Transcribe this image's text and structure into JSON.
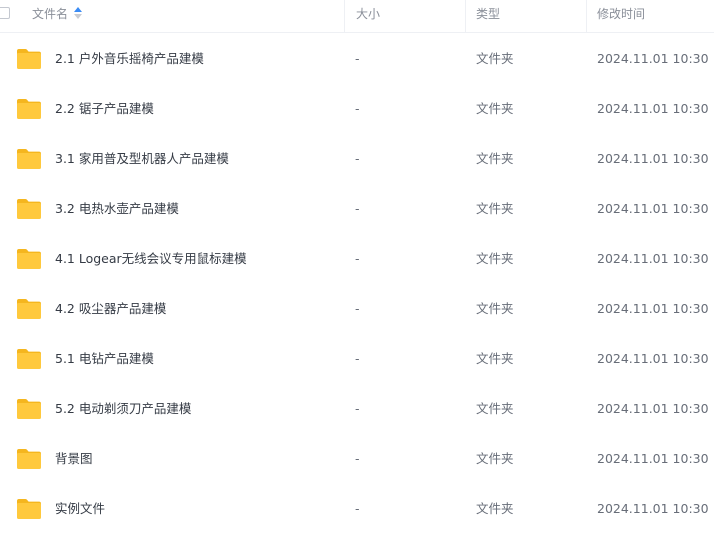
{
  "header": {
    "name_label": "文件名",
    "size_label": "大小",
    "type_label": "类型",
    "time_label": "修改时间",
    "sort_icon": "sort-arrows-icon"
  },
  "colors": {
    "folder_yellow": "#ffc93d",
    "folder_tab": "#f5b61e",
    "sort_active": "#3b8cf5"
  },
  "rows": [
    {
      "name": "2.1 户外音乐摇椅产品建模",
      "size": "-",
      "type": "文件夹",
      "modified": "2024.11.01 10:30",
      "icon": "folder-icon"
    },
    {
      "name": "2.2 锯子产品建模",
      "size": "-",
      "type": "文件夹",
      "modified": "2024.11.01 10:30",
      "icon": "folder-icon"
    },
    {
      "name": "3.1 家用普及型机器人产品建模",
      "size": "-",
      "type": "文件夹",
      "modified": "2024.11.01 10:30",
      "icon": "folder-icon"
    },
    {
      "name": "3.2 电热水壶产品建模",
      "size": "-",
      "type": "文件夹",
      "modified": "2024.11.01 10:30",
      "icon": "folder-icon"
    },
    {
      "name": "4.1 Logear无线会议专用鼠标建模",
      "size": "-",
      "type": "文件夹",
      "modified": "2024.11.01 10:30",
      "icon": "folder-icon"
    },
    {
      "name": "4.2 吸尘器产品建模",
      "size": "-",
      "type": "文件夹",
      "modified": "2024.11.01 10:30",
      "icon": "folder-icon"
    },
    {
      "name": "5.1 电钻产品建模",
      "size": "-",
      "type": "文件夹",
      "modified": "2024.11.01 10:30",
      "icon": "folder-icon"
    },
    {
      "name": "5.2 电动剃须刀产品建模",
      "size": "-",
      "type": "文件夹",
      "modified": "2024.11.01 10:30",
      "icon": "folder-icon"
    },
    {
      "name": "背景图",
      "size": "-",
      "type": "文件夹",
      "modified": "2024.11.01 10:30",
      "icon": "folder-icon"
    },
    {
      "name": "实例文件",
      "size": "-",
      "type": "文件夹",
      "modified": "2024.11.01 10:30",
      "icon": "folder-icon"
    }
  ]
}
